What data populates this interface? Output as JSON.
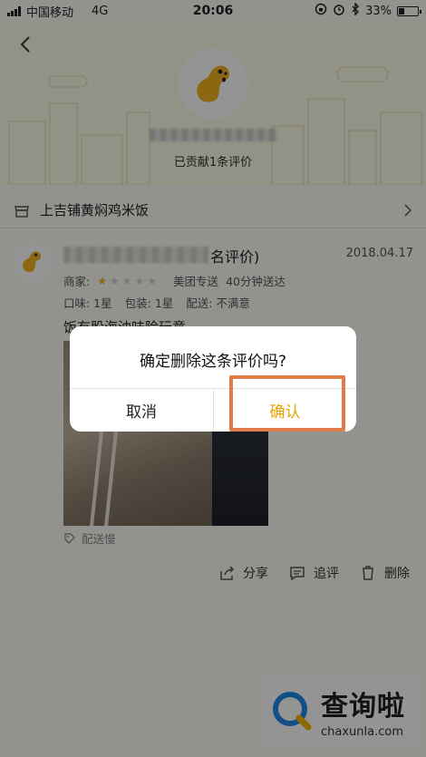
{
  "status_bar": {
    "carrier": "中国移动",
    "network": "4G",
    "time": "20:06",
    "battery_pct": "33%",
    "battery_level": 0.33
  },
  "header": {
    "contrib_text": "已贡献1条评价"
  },
  "shop": {
    "name": "上吉铺黄焖鸡米饭"
  },
  "review": {
    "title_tail": "名评价)",
    "date": "2018.04.17",
    "merchant_label": "商家:",
    "merchant_rating": 1,
    "merchant_rating_max": 5,
    "delivery_type": "美团专送",
    "delivery_time": "40分钟送达",
    "taste": "口味: 1星",
    "packaging": "包装: 1星",
    "delivery": "配送: 不满意",
    "text": "饭有股海油味险玩意",
    "tag": "配送慢",
    "actions": {
      "share": "分享",
      "followup": "追评",
      "delete": "删除"
    }
  },
  "dialog": {
    "title": "确定删除这条评价吗?",
    "cancel": "取消",
    "confirm": "确认"
  },
  "watermark": {
    "cn": "查询啦",
    "en": "chaxunla.com"
  },
  "colors": {
    "accent": "#e6a400",
    "highlight": "#e07b4a",
    "mascot": "#f2b01e"
  }
}
